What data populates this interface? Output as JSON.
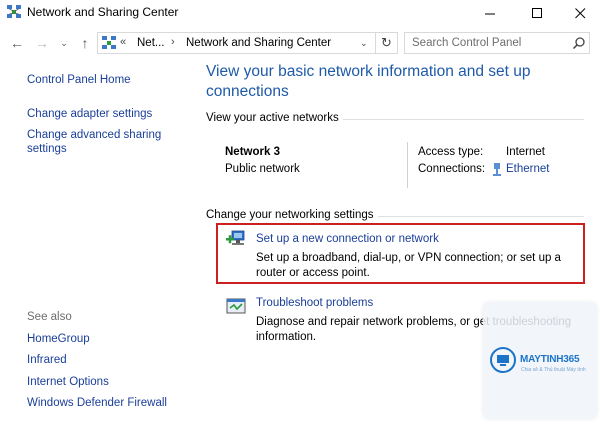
{
  "window": {
    "title": "Network and Sharing Center",
    "minimize_glyph": "—",
    "maximize_glyph": "☐",
    "close_glyph": "✕"
  },
  "nav": {
    "back_glyph": "←",
    "forward_glyph": "→",
    "dropdown_glyph": "⌄",
    "up_glyph": "↑",
    "address": {
      "chevron": "«",
      "crumb1": "Net...",
      "separator": "›",
      "crumb2": "Network and Sharing Center",
      "dropdown_glyph": "⌄"
    },
    "refresh_glyph": "↻",
    "search": {
      "placeholder": "Search Control Panel",
      "value": ""
    }
  },
  "sidebar": {
    "home": "Control Panel Home",
    "links": [
      "Change adapter settings",
      "Change advanced sharing settings"
    ],
    "see_also_label": "See also",
    "see_also": [
      "HomeGroup",
      "Infrared",
      "Internet Options",
      "Windows Defender Firewall"
    ]
  },
  "main": {
    "title": "View your basic network information and set up connections",
    "active_networks_label": "View your active networks",
    "network": {
      "name": "Network  3",
      "type": "Public network",
      "access_type_label": "Access type:",
      "access_type_value": "Internet",
      "connections_label": "Connections:",
      "connections_value": "Ethernet"
    },
    "change_settings_label": "Change your networking settings",
    "tasks": [
      {
        "link": "Set up a new connection or network",
        "desc": "Set up a broadband, dial-up, or VPN connection; or set up a router or access point."
      },
      {
        "link": "Troubleshoot problems",
        "desc": "Diagnose and repair network problems, or get troubleshooting information."
      }
    ]
  },
  "watermark": {
    "brand": "MAYTINH365",
    "sub": "Chia sẻ & Thủ thuật Máy tính"
  },
  "colors": {
    "link": "#1a3f99",
    "title": "#1e5aa8",
    "highlight": "#cc1f1f",
    "brand": "#1b74c9"
  },
  "icons": {
    "app": "network-center-icon",
    "search": "search-icon",
    "ethernet": "ethernet-icon",
    "new_connection": "new-connection-icon",
    "troubleshoot": "troubleshoot-icon"
  }
}
